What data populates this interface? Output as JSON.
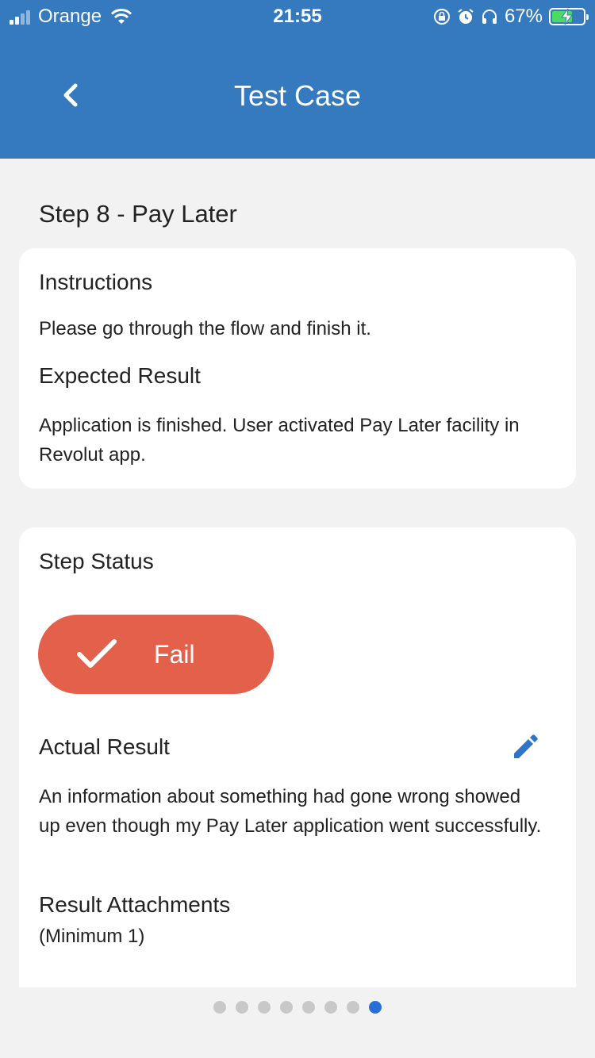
{
  "status_bar": {
    "carrier": "Orange",
    "time": "21:55",
    "battery_percent": "67%",
    "battery_level": 0.67,
    "icons": [
      "signal-icon",
      "wifi-icon",
      "orientation-lock-icon",
      "alarm-icon",
      "headphones-icon",
      "battery-icon"
    ]
  },
  "header": {
    "title": "Test Case",
    "back_icon": "chevron-left-icon",
    "background_color": "#357abf"
  },
  "step": {
    "title": "Step 8 - Pay Later"
  },
  "instructions_card": {
    "instructions_heading": "Instructions",
    "instructions_text": "Please go through the flow and finish it.",
    "expected_heading": "Expected Result",
    "expected_text": "Application is finished. User activated Pay Later facility in Revolut app."
  },
  "status_card": {
    "status_heading": "Step Status",
    "status_button_label": "Fail",
    "status_button_icon": "checkmark-icon",
    "status_button_color": "#e3614a",
    "actual_heading": "Actual Result",
    "edit_icon": "pencil-icon",
    "actual_text": "An information about something had gone wrong showed up even though my Pay Later application went successfully.",
    "attachments_heading": "Result Attachments",
    "attachments_note": "(Minimum 1)"
  },
  "pagination": {
    "total": 8,
    "current": 8,
    "active_color": "#2a6fd8"
  }
}
